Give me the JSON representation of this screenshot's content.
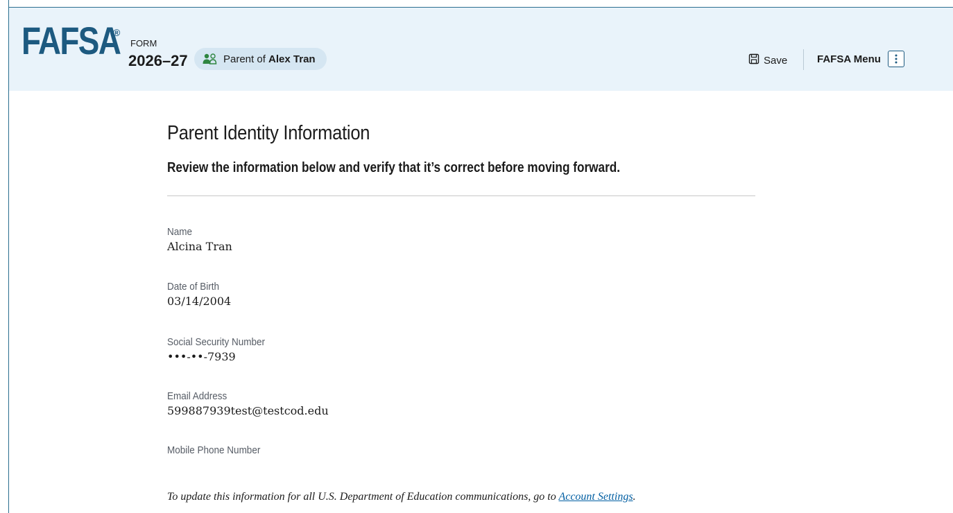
{
  "header": {
    "logo": "FAFSA",
    "logo_mark": "®",
    "form_label": "FORM",
    "form_year": "2026–27",
    "role_prefix": "Parent of",
    "role_name": "Alex Tran",
    "role_icon": "people-icon",
    "save_label": "Save",
    "save_icon": "floppy-disk-icon",
    "menu_label": "FAFSA Menu",
    "menu_icon": "kebab-vertical-icon"
  },
  "page": {
    "title": "Parent Identity Information",
    "subtitle": "Review the information below and verify that it’s correct before moving forward."
  },
  "fields": [
    {
      "label": "Name",
      "value": "Alcina Tran"
    },
    {
      "label": "Date of Birth",
      "value": "03/14/2004"
    },
    {
      "label": "Social Security Number",
      "value": "•••-••-7939"
    },
    {
      "label": "Email Address",
      "value": "599887939test@testcod.edu"
    },
    {
      "label": "Mobile Phone Number",
      "value": ""
    }
  ],
  "note": {
    "text": "To update this information for all U.S. Department of Education communications, go to ",
    "link": "Account Settings",
    "suffix": "."
  },
  "colors": {
    "brand": "#1d5a80",
    "header_bg": "#e9f3fa",
    "pill_bg": "#d5e6f2",
    "role_icon_green": "#2e8540",
    "link": "#005ea2"
  }
}
